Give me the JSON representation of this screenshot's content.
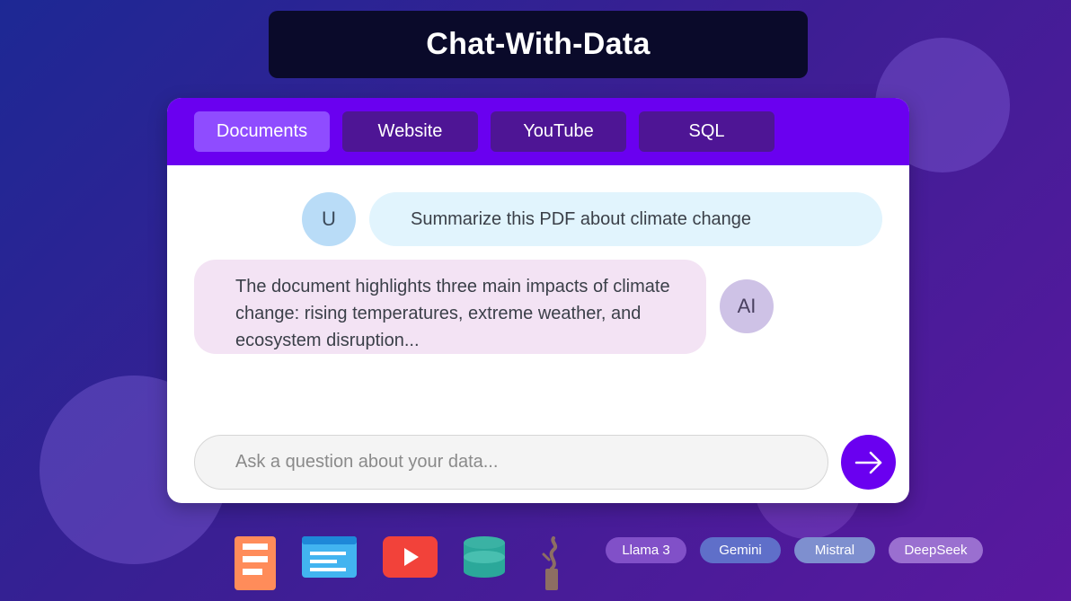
{
  "app": {
    "title": "Chat-With-Data"
  },
  "tabs": [
    {
      "label": "Documents",
      "active": true
    },
    {
      "label": "Website",
      "active": false
    },
    {
      "label": "YouTube",
      "active": false
    },
    {
      "label": "SQL",
      "active": false
    }
  ],
  "messages": [
    {
      "role": "user",
      "avatar": "U",
      "text": "Summarize this PDF about climate change"
    },
    {
      "role": "ai",
      "avatar": "AI",
      "text": "The document highlights three main impacts of climate change: rising temperatures, extreme weather, and ecosystem disruption..."
    }
  ],
  "input": {
    "placeholder": "Ask a question about your data...",
    "value": ""
  },
  "send_button": {
    "icon": "arrow-right-icon"
  },
  "source_icons": [
    {
      "name": "document-icon"
    },
    {
      "name": "website-icon"
    },
    {
      "name": "youtube-icon"
    },
    {
      "name": "database-icon"
    },
    {
      "name": "sql-icon"
    }
  ],
  "models": [
    {
      "label": "Llama 3"
    },
    {
      "label": "Gemini"
    },
    {
      "label": "Mistral"
    },
    {
      "label": "DeepSeek"
    }
  ],
  "colors": {
    "accent": "#6a00f0",
    "active_tab": "#8f4cff",
    "inactive_tab": "#4e1595",
    "title_bg": "#0a0a2a",
    "user_bubble": "#e1f4fd",
    "ai_bubble": "#f3e3f4"
  }
}
